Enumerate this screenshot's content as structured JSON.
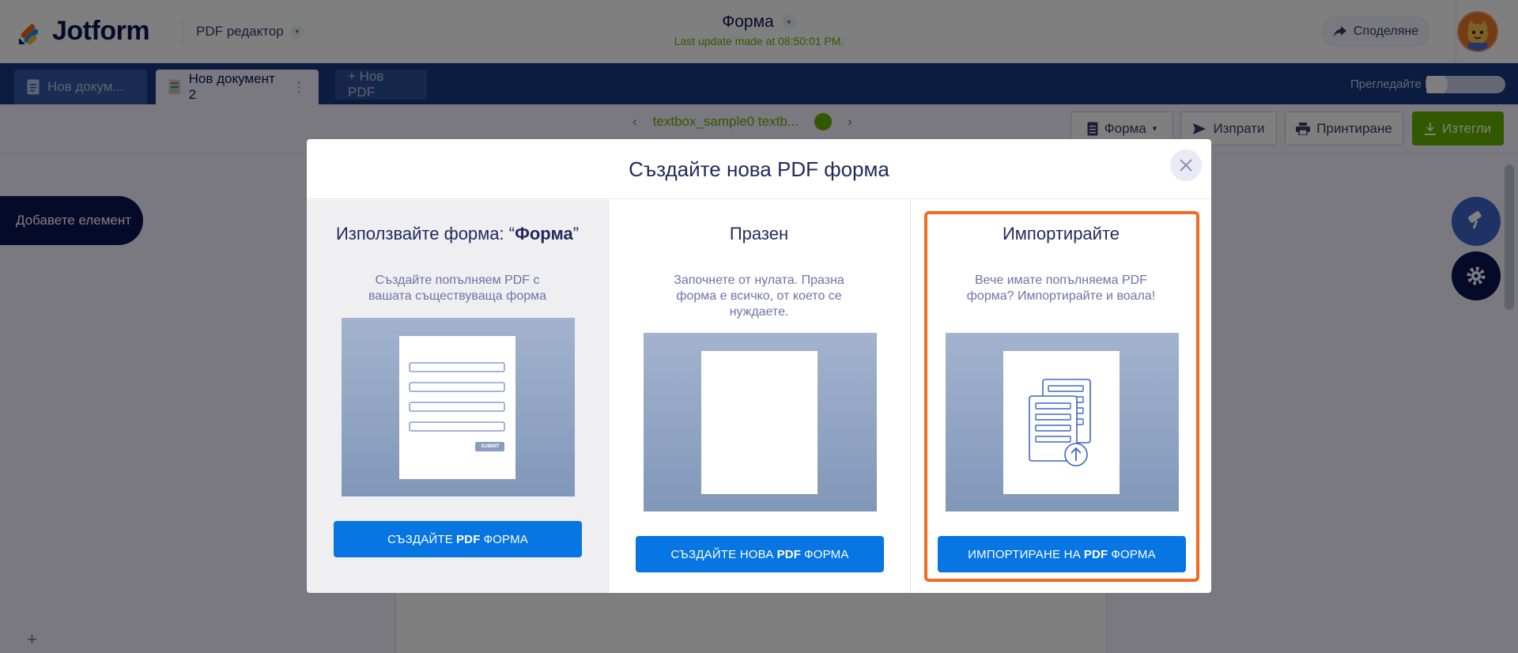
{
  "header": {
    "logo_text": "Jotform",
    "product": "PDF редактор",
    "doc_title": "Форма",
    "last_update": "Last update made at 08:50:01 PM.",
    "share_label": "Споделяне"
  },
  "tabs": [
    {
      "label": "Нов докум...",
      "state": "inactive"
    },
    {
      "label": "Нов документ 2",
      "state": "active"
    },
    {
      "label": "+ Нов PDF",
      "state": "inactive"
    }
  ],
  "preview_label": "Прегледайте PDF",
  "toolbar": {
    "page_label": "textbox_sample0 textb...",
    "form_label": "Форма",
    "send_label": "Изпрати",
    "print_label": "Принтиране",
    "download_label": "Изтегли"
  },
  "sidebar": {
    "add_element": "Добавете елемент"
  },
  "modal": {
    "title": "Създайте нова PDF форма",
    "columns": [
      {
        "title_prefix": "Използвайте форма: “",
        "title_bold": "Форма",
        "title_suffix": "”",
        "description": "Създайте попълняем PDF с вашата съществуваща форма",
        "cta_pre": "СЪЗДАЙТЕ",
        "cta_bold": "PDF",
        "cta_post": "ФОРМА",
        "submit_label": "SUBMIT"
      },
      {
        "title": "Празен",
        "description": "Започнете от нулата. Празна форма е всичко, от което се нуждаете.",
        "cta_pre": "СЪЗДАЙТЕ НОВА",
        "cta_bold": "PDF",
        "cta_post": "ФОРМА"
      },
      {
        "title": "Импортирайте",
        "description": "Вече имате попълняема PDF форма? Импортирайте и воала!",
        "cta_pre": "ИМПОРТИРАНЕ НА",
        "cta_bold": "PDF",
        "cta_post": "ФОРМА",
        "highlighted": true
      }
    ]
  },
  "colors": {
    "brand_navy": "#0a1551",
    "tabbar": "#193880",
    "cta_blue": "#0775e2",
    "success_green": "#64b200",
    "highlight_orange": "#f26b21"
  }
}
